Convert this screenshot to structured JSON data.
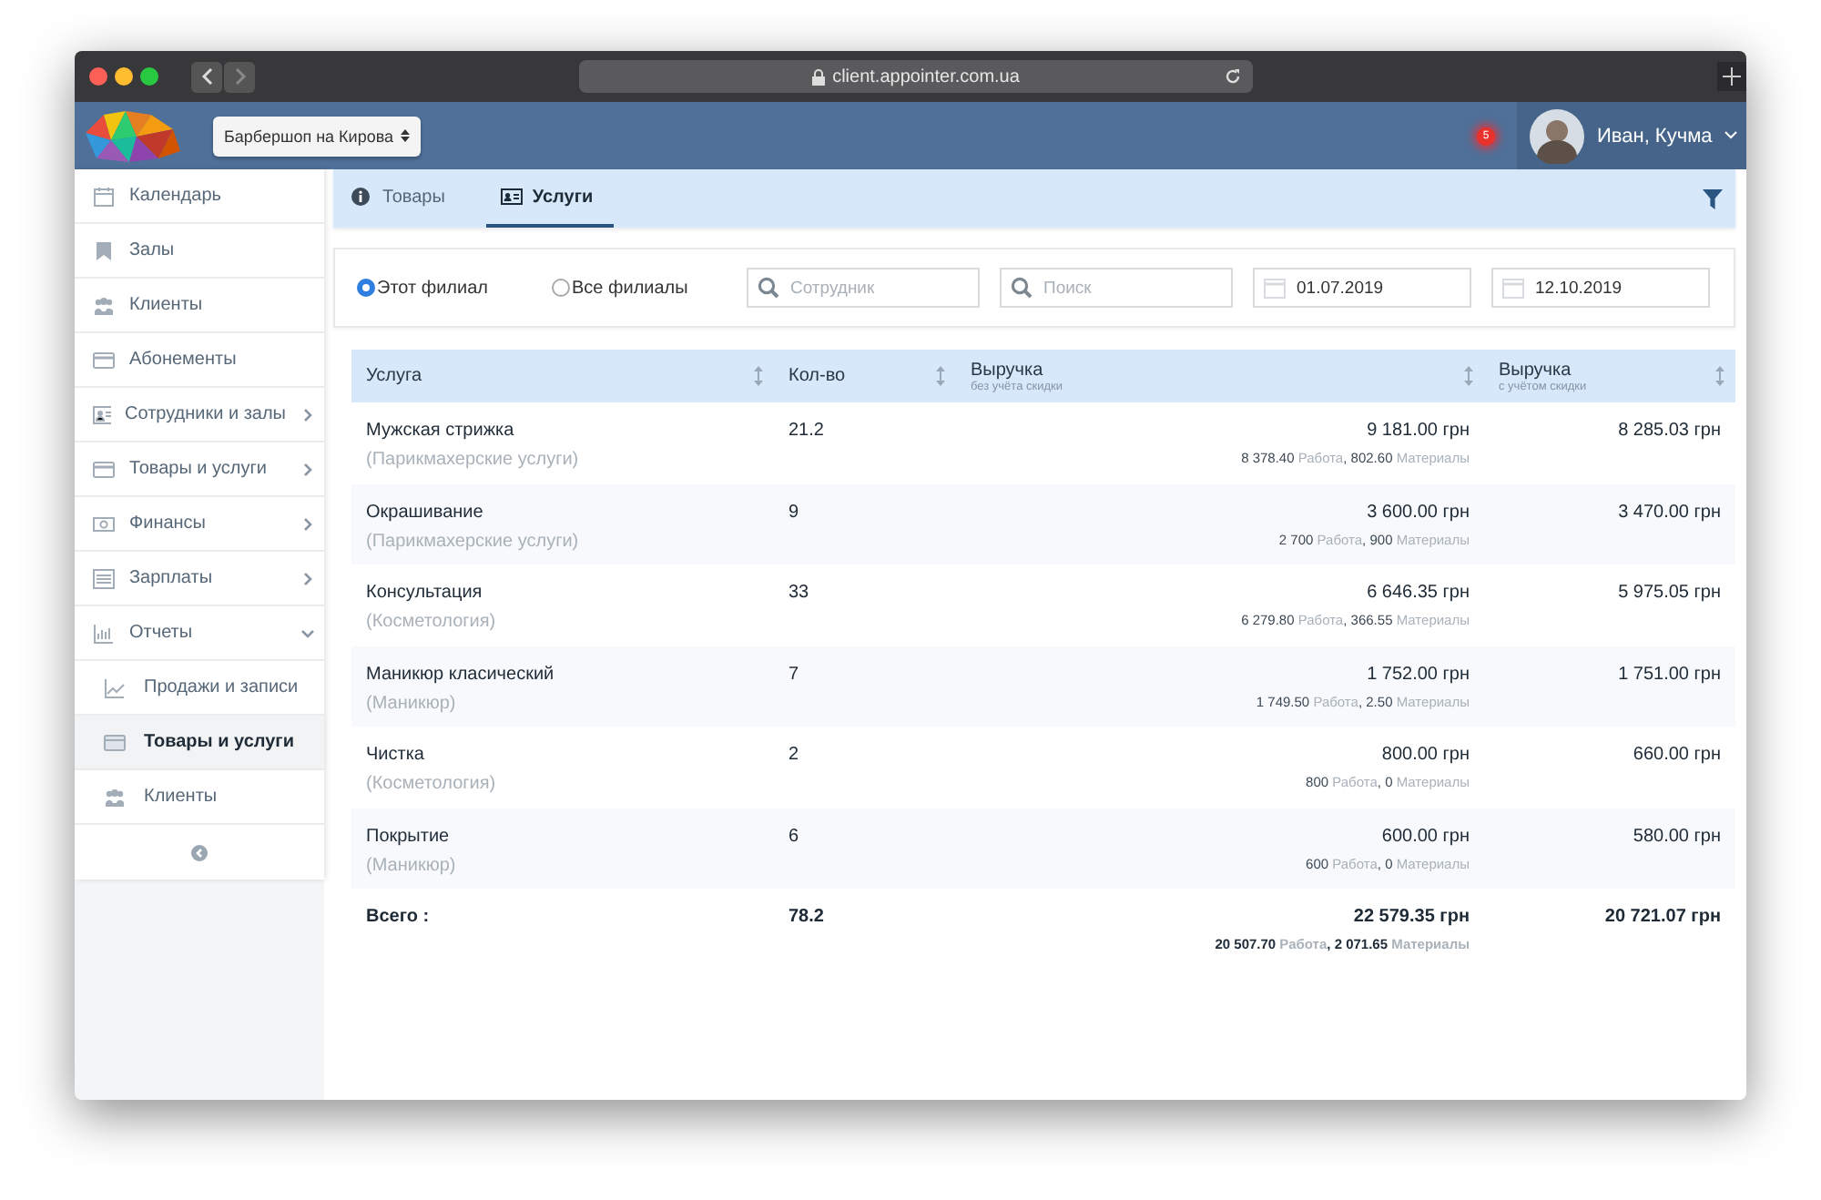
{
  "browser": {
    "url": "client.appointer.com.ua"
  },
  "header": {
    "branch": "Барбершоп на Кирова",
    "notifications": "5",
    "user": "Иван, Кучма"
  },
  "sidebar": {
    "items": [
      {
        "label": "Календарь"
      },
      {
        "label": "Залы"
      },
      {
        "label": "Клиенты"
      },
      {
        "label": "Абонементы"
      },
      {
        "label": "Сотрудники и залы",
        "expanded": false
      },
      {
        "label": "Товары и услуги",
        "expanded": false
      },
      {
        "label": "Финансы",
        "expanded": false
      },
      {
        "label": "Зарплаты",
        "expanded": false
      },
      {
        "label": "Отчеты",
        "expanded": true,
        "children": [
          {
            "label": "Продажи и записи",
            "selected": false
          },
          {
            "label": "Товары и услуги",
            "selected": true
          },
          {
            "label": "Клиенты",
            "selected": false
          }
        ]
      }
    ]
  },
  "tabs": [
    {
      "label": "Товары",
      "selected": false
    },
    {
      "label": "Услуги",
      "selected": true
    }
  ],
  "filters": {
    "branches": [
      {
        "label": "Этот филиал",
        "selected": true
      },
      {
        "label": "Все филиалы",
        "selected": false
      }
    ],
    "search_fields": [
      {
        "placeholder": "Сотрудник"
      },
      {
        "placeholder": "Поиск"
      }
    ],
    "dates": [
      {
        "value": "01.07.2019"
      },
      {
        "value": "12.10.2019"
      }
    ]
  },
  "table": {
    "columns": [
      {
        "label": "Услуга"
      },
      {
        "label": "Кол-во"
      },
      {
        "label": "Выручка",
        "note": "без учёта скидки"
      },
      {
        "label": "Выручка",
        "note": "с учётом скидки"
      }
    ],
    "rows": [
      {
        "service": "Мужская стрижка",
        "category": "(Парикмахерские услуги)",
        "count": "21.2",
        "revenue": "9 181.00 грн",
        "breakdown": "**8 378.40** Работа**,** **802.60** Материалы",
        "revenue_discounted": "8 285.03 грн"
      },
      {
        "service": "Окрашивание",
        "category": "(Парикмахерские услуги)",
        "count": "9",
        "revenue": "3 600.00 грн",
        "breakdown": "**2 700** Работа**,** **900** Материалы",
        "revenue_discounted": "3 470.00 грн"
      },
      {
        "service": "Консультация",
        "category": "(Косметология)",
        "count": "33",
        "revenue": "6 646.35 грн",
        "breakdown": "**6 279.80** Работа**,** **366.55** Материалы",
        "revenue_discounted": "5 975.05 грн"
      },
      {
        "service": "Маникюр класический",
        "category": "(Маникюр)",
        "count": "7",
        "revenue": "1 752.00 грн",
        "breakdown": "**1 749.50** Работа**,** **2.50** Материалы",
        "revenue_discounted": "1 751.00 грн"
      },
      {
        "service": "Чистка",
        "category": "(Косметология)",
        "count": "2",
        "revenue": "800.00 грн",
        "breakdown": "**800** Работа**,** **0** Материалы",
        "revenue_discounted": "660.00 грн"
      },
      {
        "service": "Покрытие",
        "category": "(Маникюр)",
        "count": "6",
        "revenue": "600.00 грн",
        "breakdown": "**600** Работа**,** **0** Материалы",
        "revenue_discounted": "580.00 грн"
      }
    ],
    "total": {
      "label": "Всего :",
      "count": "78.2",
      "revenue": "22 579.35 грн",
      "breakdown": "**20 507.70** Работа**,** **2 071.65** Материалы",
      "revenue_discounted": "20 721.07 грн"
    }
  }
}
